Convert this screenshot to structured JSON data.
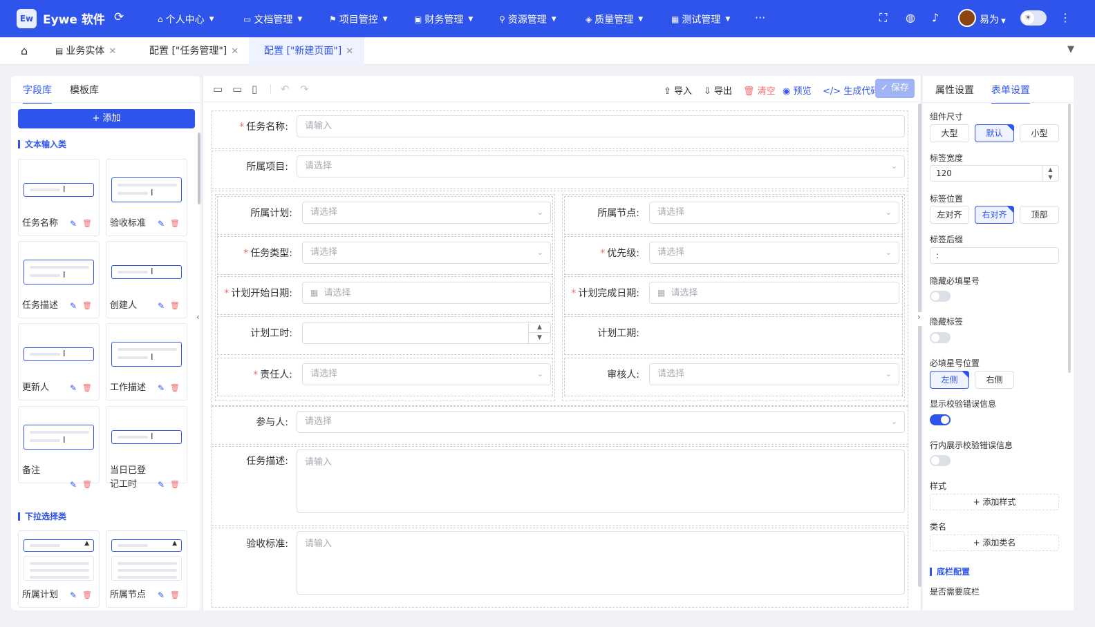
{
  "app": {
    "logo": "Ew",
    "name": "Eywe 软件"
  },
  "nav": [
    "个人中心",
    "文档管理",
    "项目管控",
    "财务管理",
    "资源管理",
    "质量管理",
    "测试管理"
  ],
  "user": {
    "name": "易为"
  },
  "tabs": [
    {
      "label": "业务实体"
    },
    {
      "label": "配置 [\"任务管理\"]"
    },
    {
      "label": "配置 [\"新建页面\"]"
    }
  ],
  "left_panel": {
    "tabs": [
      "字段库",
      "模板库"
    ],
    "add_label": "+ 添加",
    "section_text": "文本输入类",
    "section_select": "下拉选择类",
    "text_fields": [
      "任务名称",
      "验收标准",
      "任务描述",
      "创建人",
      "更新人",
      "工作描述",
      "备注",
      "当日已登记工时"
    ],
    "select_fields": [
      "所属计划",
      "所属节点"
    ]
  },
  "toolbar": {
    "import": "导入",
    "export": "导出",
    "clear": "清空",
    "preview": "预览",
    "gen_code": "生成代码",
    "save": "保存"
  },
  "form": {
    "task_name": {
      "label": "任务名称:",
      "placeholder": "请输入"
    },
    "project": {
      "label": "所属项目:",
      "placeholder": "请选择"
    },
    "plan": {
      "label": "所属计划:",
      "placeholder": "请选择"
    },
    "node": {
      "label": "所属节点:",
      "placeholder": "请选择"
    },
    "task_type": {
      "label": "任务类型:",
      "placeholder": "请选择"
    },
    "priority": {
      "label": "优先级:",
      "placeholder": "请选择"
    },
    "start_date": {
      "label": "计划开始日期:",
      "placeholder": "请选择"
    },
    "end_date": {
      "label": "计划完成日期:",
      "placeholder": "请选择"
    },
    "plan_hours": {
      "label": "计划工时:"
    },
    "plan_period": {
      "label": "计划工期:"
    },
    "owner": {
      "label": "责任人:",
      "placeholder": "请选择"
    },
    "reviewer": {
      "label": "审核人:",
      "placeholder": "请选择"
    },
    "participants": {
      "label": "参与人:",
      "placeholder": "请选择"
    },
    "task_desc": {
      "label": "任务描述:",
      "placeholder": "请输入"
    },
    "acceptance": {
      "label": "验收标准:",
      "placeholder": "请输入"
    }
  },
  "right_panel": {
    "tabs": [
      "属性设置",
      "表单设置"
    ],
    "size_label": "组件尺寸",
    "sizes": [
      "大型",
      "默认",
      "小型"
    ],
    "label_width_label": "标签宽度",
    "label_width": "120",
    "label_pos_label": "标签位置",
    "label_pos": [
      "左对齐",
      "右对齐",
      "顶部"
    ],
    "label_suffix_label": "标签后缀",
    "label_suffix": ":",
    "hide_required_label": "隐藏必填星号",
    "hide_label_label": "隐藏标签",
    "required_pos_label": "必填星号位置",
    "required_pos": [
      "左侧",
      "右侧"
    ],
    "show_error_label": "显示校验错误信息",
    "inline_error_label": "行内展示校验错误信息",
    "style_label": "样式",
    "add_style": "+ 添加样式",
    "class_label": "类名",
    "add_class": "+ 添加类名",
    "footer_section": "底栏配置",
    "footer_need_label": "是否需要底栏"
  }
}
